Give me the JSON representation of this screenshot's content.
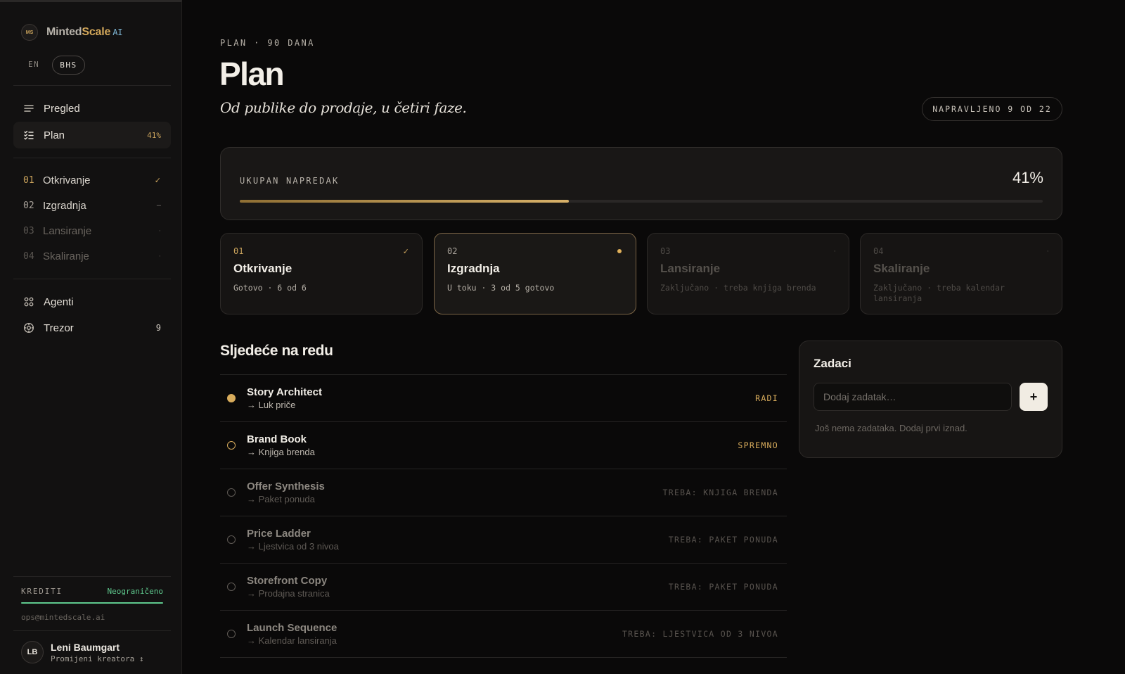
{
  "brand": {
    "logo_text": "MS",
    "name_part1": "Minted",
    "name_part2": "Scale",
    "name_part3": "AI"
  },
  "lang": {
    "en": "EN",
    "bhs": "BHS"
  },
  "nav": {
    "overview": "Pregled",
    "plan": "Plan",
    "plan_badge": "41%",
    "agents": "Agenti",
    "vault": "Trezor",
    "vault_count": "9"
  },
  "sidebar_phases": [
    {
      "num": "01",
      "label": "Otkrivanje",
      "mark": "✓"
    },
    {
      "num": "02",
      "label": "Izgradnja",
      "mark": "–"
    },
    {
      "num": "03",
      "label": "Lansiranje",
      "mark": "·"
    },
    {
      "num": "04",
      "label": "Skaliranje",
      "mark": "·"
    }
  ],
  "credits": {
    "label": "KREDITI",
    "value": "Neograničeno",
    "email": "ops@mintedscale.ai"
  },
  "user": {
    "initials": "LB",
    "name": "Leni Baumgart",
    "switch": "Promijeni kreatora ↕"
  },
  "header": {
    "eyebrow": "PLAN · 90 DANA",
    "title": "Plan",
    "subtitle": "Od publike do prodaje, u četiri faze.",
    "done": "NAPRAVLJENO 9 OD 22"
  },
  "progress": {
    "label": "UKUPAN NAPREDAK",
    "value_text": "41%",
    "fraction": 0.41
  },
  "phases": [
    {
      "num": "01",
      "title": "Otkrivanje",
      "sub": "Gotovo · 6 od 6",
      "mark": "✓",
      "state": "done"
    },
    {
      "num": "02",
      "title": "Izgradnja",
      "sub": "U toku · 3 od 5 gotovo",
      "mark": "",
      "state": "current"
    },
    {
      "num": "03",
      "title": "Lansiranje",
      "sub": "Zaključano · treba knjiga brenda",
      "mark": "·",
      "state": "locked"
    },
    {
      "num": "04",
      "title": "Skaliranje",
      "sub": "Zaključano · treba kalendar lansiranja",
      "mark": "·",
      "state": "locked"
    }
  ],
  "next": {
    "title": "Sljedeće na redu",
    "items": [
      {
        "title": "Story Architect",
        "sub": "→ Luk priče",
        "status": "RADI",
        "state": "running"
      },
      {
        "title": "Brand Book",
        "sub": "→ Knjiga brenda",
        "status": "SPREMNO",
        "state": "ready"
      },
      {
        "title": "Offer Synthesis",
        "sub": "→ Paket ponuda",
        "status": "TREBA: KNJIGA BRENDA",
        "state": "blocked"
      },
      {
        "title": "Price Ladder",
        "sub": "→ Ljestvica od 3 nivoa",
        "status": "TREBA: PAKET PONUDA",
        "state": "blocked"
      },
      {
        "title": "Storefront Copy",
        "sub": "→ Prodajna stranica",
        "status": "TREBA: PAKET PONUDA",
        "state": "blocked"
      },
      {
        "title": "Launch Sequence",
        "sub": "→ Kalendar lansiranja",
        "status": "TREBA: LJESTVICA OD 3 NIVOA",
        "state": "blocked"
      }
    ]
  },
  "tasks": {
    "title": "Zadaci",
    "placeholder": "Dodaj zadatak…",
    "add_label": "+",
    "empty": "Još nema zadataka. Dodaj prvi iznad."
  },
  "colors": {
    "accent": "#d8ac5c",
    "credits": "#5fc98e",
    "bg": "#0a0909"
  }
}
